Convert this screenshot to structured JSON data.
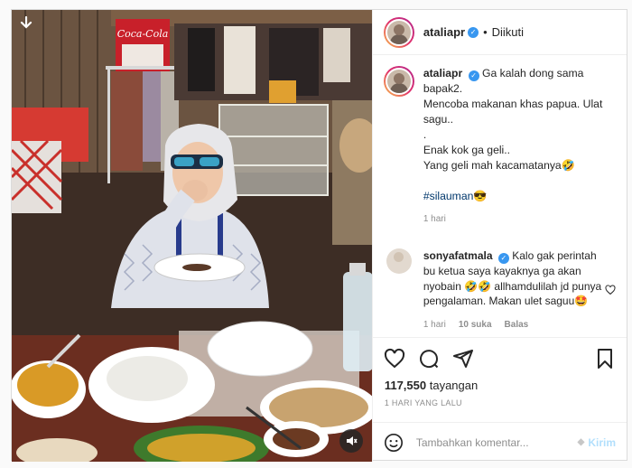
{
  "header": {
    "username": "ataliapr",
    "follow_state": "Diikuti"
  },
  "caption": {
    "username": "ataliapr",
    "lines": [
      "Ga kalah dong sama bapak2.",
      "Mencoba makanan khas papua. Ulat",
      "sagu..",
      ".",
      "Enak kok ga geli..",
      "Yang geli mah kacamatanya🤣",
      "",
      "#silauman😎"
    ],
    "hashtag": "#silauman",
    "hashtag_emoji": "😎",
    "time": "1 hari"
  },
  "comment": {
    "username": "sonyafatmala",
    "text": "Kalo gak perintah bu ketua saya kayaknya ga akan nyobain 🤣🤣 allhamdulilah jd punya pengalaman. Makan ulet saguu🤩",
    "time": "1 hari",
    "likes": "10 suka",
    "reply": "Balas"
  },
  "stats": {
    "views": "117,550",
    "views_label": "tayangan",
    "date": "1 HARI YANG LALU"
  },
  "add_comment": {
    "placeholder": "Tambahkan komentar...",
    "post_label": "Kirim"
  },
  "media": {
    "sign_text": "Coca-Cola"
  },
  "colors": {
    "verified": "#3897f0",
    "hashtag": "#00376b",
    "muted": "#8e8e8e",
    "post_disabled": "#b2dffc"
  }
}
